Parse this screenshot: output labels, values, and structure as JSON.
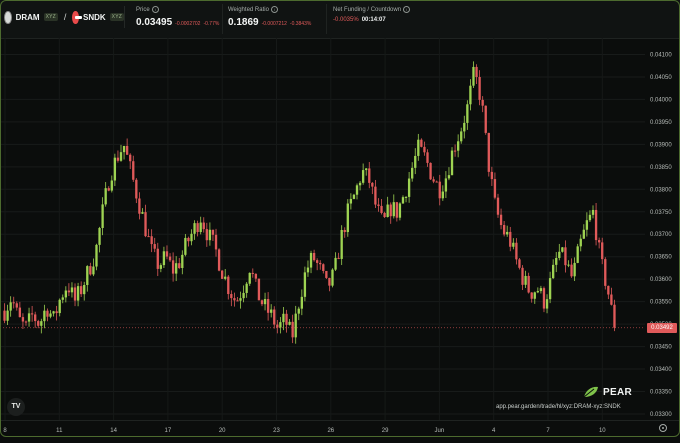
{
  "pair": {
    "base_symbol": "DRAM",
    "base_badge": "XYZ",
    "separator": "/",
    "quote_symbol": "SNDK",
    "quote_badge": "XYZ"
  },
  "metrics": {
    "price": {
      "label": "Price",
      "value": "0.03495",
      "change_abs": "-0.0002702",
      "change_pct": "-0.77%"
    },
    "weighted_ratio": {
      "label": "Weighted Ratio",
      "value": "0.1869",
      "change_abs": "-0.0007212",
      "change_pct": "-0.3843%"
    },
    "funding": {
      "label": "Net Funding / Countdown",
      "rate": "-0.0035%",
      "countdown": "00:14:07"
    }
  },
  "y_axis": {
    "ticks": [
      "0.04100",
      "0.04050",
      "0.04000",
      "0.03950",
      "0.03900",
      "0.03850",
      "0.03800",
      "0.03750",
      "0.03700",
      "0.03650",
      "0.03600",
      "0.03550",
      "0.03500",
      "0.03450",
      "0.03400",
      "0.03350",
      "0.03300"
    ],
    "current_price_label": "0.03492"
  },
  "x_axis": {
    "ticks": [
      "8",
      "11",
      "14",
      "17",
      "20",
      "23",
      "26",
      "29",
      "Jun",
      "4",
      "7",
      "10"
    ]
  },
  "brand": {
    "name": "PEAR",
    "url": "app.pear.garden/trade/hl/xyz:DRAM-xyz:SNDK"
  },
  "tv_logo": "TV",
  "colors": {
    "up": "#9ed352",
    "down": "#e05a5a",
    "background": "#0b0d0c",
    "accent_border": "#4c6a2e"
  },
  "chart_data": {
    "type": "candlestick",
    "ylim": [
      0.033,
      0.0411
    ],
    "x_ticks": [
      "8",
      "11",
      "14",
      "17",
      "20",
      "23",
      "26",
      "29",
      "Jun",
      "4",
      "7",
      "10"
    ],
    "close_series": [
      0.0353,
      0.0356,
      0.0351,
      0.0349,
      0.0352,
      0.035,
      0.0354,
      0.0351,
      0.0356,
      0.0359,
      0.0355,
      0.0358,
      0.0362,
      0.0366,
      0.0375,
      0.0383,
      0.0387,
      0.039,
      0.0384,
      0.0378,
      0.0372,
      0.0366,
      0.0363,
      0.0365,
      0.0362,
      0.0364,
      0.0368,
      0.0371,
      0.0374,
      0.037,
      0.0367,
      0.0362,
      0.0358,
      0.0355,
      0.0358,
      0.0363,
      0.0357,
      0.0354,
      0.0352,
      0.0349,
      0.0351,
      0.0347,
      0.0355,
      0.0362,
      0.0365,
      0.0362,
      0.0358,
      0.0361,
      0.0369,
      0.0375,
      0.0379,
      0.0384,
      0.0382,
      0.0376,
      0.0372,
      0.0376,
      0.0375,
      0.0379,
      0.0384,
      0.0389,
      0.0387,
      0.0383,
      0.038,
      0.0383,
      0.0389,
      0.0393,
      0.0398,
      0.0406,
      0.04,
      0.0386,
      0.0376,
      0.0371,
      0.0369,
      0.0364,
      0.036,
      0.0357,
      0.0358,
      0.0355,
      0.036,
      0.0366,
      0.0364,
      0.036,
      0.0367,
      0.0372,
      0.0375,
      0.0364,
      0.0358,
      0.03492
    ]
  }
}
